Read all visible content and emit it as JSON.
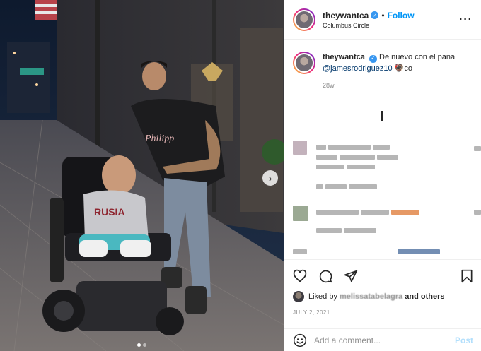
{
  "header": {
    "username": "theywantca",
    "separator": "•",
    "follow_label": "Follow",
    "location": "Columbus Circle",
    "more_label": "···"
  },
  "caption": {
    "username": "theywantca",
    "text": "De nuevo con el pana",
    "mention": "@jamesrodriguez10",
    "emoji": "🦃",
    "suffix": "co",
    "time": "28w"
  },
  "photo": {
    "next_label": "›",
    "slide_count": 2,
    "active_slide": 1
  },
  "likes": {
    "prefix": "Liked by",
    "liker": "melissatabelagra",
    "suffix": "and others"
  },
  "date": "JULY 2, 2021",
  "add_comment": {
    "placeholder": "Add a comment...",
    "post_label": "Post"
  },
  "icons": [
    "heart-icon",
    "comment-icon",
    "share-icon",
    "bookmark-icon",
    "emoji-icon",
    "verified-icon",
    "chevron-right-icon"
  ],
  "colors": {
    "link": "#0095f6",
    "mention": "#00376b",
    "muted": "#8e8e8e",
    "post_disabled": "#b2dffc"
  }
}
